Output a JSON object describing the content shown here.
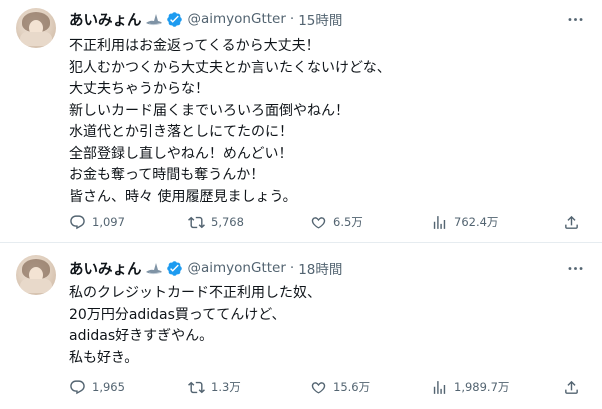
{
  "tweets": [
    {
      "name": "あいみょん",
      "handle": "@aimyonGtter",
      "separator": "·",
      "time": "15時間",
      "lines": [
        "不正利用はお金返ってくるから大丈夫！",
        "犯人むかつくから大丈夫とか言いたくないけどな、",
        "大丈夫ちゃうからな！",
        "新しいカード届くまでいろいろ面倒やねん！",
        "水道代とか引き落としにてたのに！",
        "全部登録し直しやねん！めんどい！",
        "お金も奪って時間も奪うんか！",
        "皆さん、時々 使用履歴見ましょう。"
      ],
      "replies": "1,097",
      "retweets": "5,768",
      "likes": "6.5万",
      "views": "762.4万"
    },
    {
      "name": "あいみょん",
      "handle": "@aimyonGtter",
      "separator": "·",
      "time": "18時間",
      "lines": [
        "私のクレジットカード不正利用した奴、",
        "20万円分adidas買っててんけど、",
        "adidas好きすぎやん。",
        "私も好き。"
      ],
      "replies": "1,965",
      "retweets": "1.3万",
      "likes": "15.6万",
      "views": "1,989.7万"
    }
  ],
  "colors": {
    "text": "#0f1419",
    "secondary": "#536471",
    "verified": "#1d9bf0",
    "divider": "#e6ecf0"
  },
  "icons": [
    "avatar",
    "shark-emoji-icon",
    "verified-badge-icon",
    "more-icon",
    "reply-icon",
    "retweet-icon",
    "like-icon",
    "views-icon",
    "share-icon"
  ]
}
